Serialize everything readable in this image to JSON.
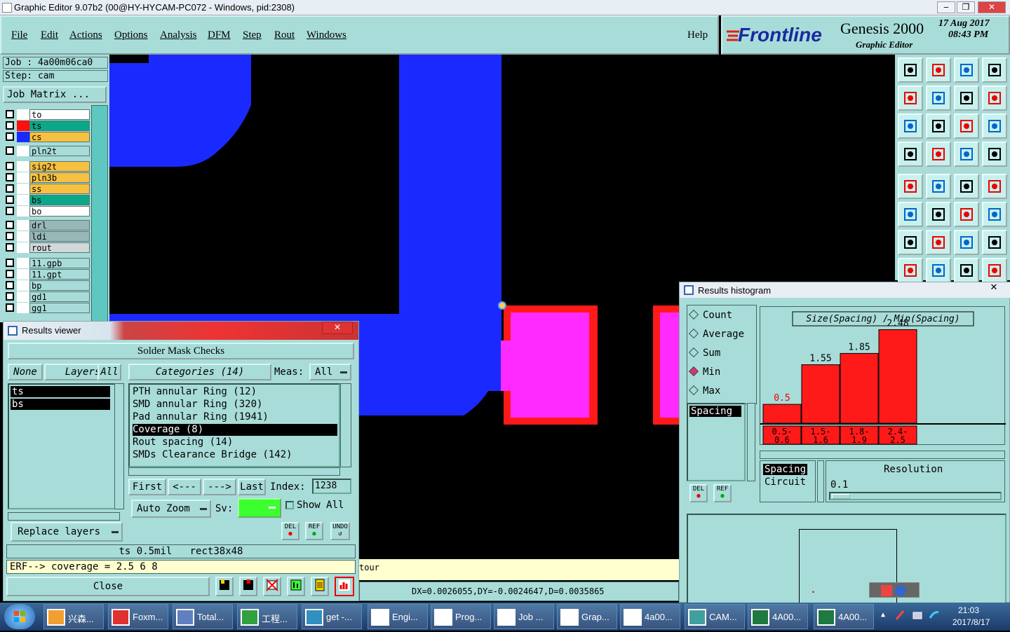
{
  "window": {
    "title": "Graphic Editor 9.07b2 (00@HY-HYCAM-PC072 - Windows, pid:2308)"
  },
  "menu": [
    "File",
    "Edit",
    "Actions",
    "Options",
    "Analysis",
    "DFM",
    "Step",
    "Rout",
    "Windows"
  ],
  "help": "Help",
  "logo": {
    "brand": "Frontline",
    "product": "Genesis 2000",
    "subtitle": "Graphic Editor",
    "date": "17 Aug 2017",
    "time": "08:43 PM"
  },
  "job": {
    "job_line": "Job : 4a00m06ca0",
    "step_line": "Step: cam",
    "matrix_button": "Job Matrix ..."
  },
  "layers": [
    {
      "name": "to",
      "color": "#ffffff",
      "swatch": "#ffffff"
    },
    {
      "name": "ts",
      "color": "#0aa888",
      "swatch": "#ff1010"
    },
    {
      "name": "cs",
      "color": "#f8c040",
      "swatch": "#1a2aff"
    },
    {
      "name": "pln2t",
      "color": "#a8dcd8",
      "swatch": "#ffffff"
    },
    {
      "name": "sig2t",
      "color": "#f8c040",
      "swatch": "#ffffff"
    },
    {
      "name": "pln3b",
      "color": "#f8c040",
      "swatch": "#ffffff"
    },
    {
      "name": "ss",
      "color": "#f8c040",
      "swatch": "#ffffff"
    },
    {
      "name": "bs",
      "color": "#0aa888",
      "swatch": "#ffffff"
    },
    {
      "name": "bo",
      "color": "#ffffff",
      "swatch": "#ffffff"
    },
    {
      "name": "drl",
      "color": "#98b8b8",
      "swatch": "#ffffff"
    },
    {
      "name": "ldi",
      "color": "#98b8b8",
      "swatch": "#ffffff"
    },
    {
      "name": "rout",
      "color": "#d0d8d8",
      "swatch": "#ffffff"
    },
    {
      "name": "11.gpb",
      "color": "#a8dcd8",
      "swatch": "#ffffff"
    },
    {
      "name": "11.gpt",
      "color": "#a8dcd8",
      "swatch": "#ffffff"
    },
    {
      "name": "bp",
      "color": "#a8dcd8",
      "swatch": "#ffffff"
    },
    {
      "name": "gd1",
      "color": "#a8dcd8",
      "swatch": "#ffffff"
    },
    {
      "name": "gg1",
      "color": "#a8dcd8",
      "swatch": "#ffffff"
    }
  ],
  "status": {
    "coords": "DX=0.0026055,DY=-0.0024647,D=0.0035865",
    "cmd_fragment": "tour"
  },
  "results_viewer": {
    "title": "Results viewer",
    "header": "Solder Mask Checks",
    "none": "None",
    "layers_btn": "Layers",
    "all": "All",
    "categories_btn": "Categories (14)",
    "meas_label": "Meas:",
    "meas_value": "All",
    "layer_items": [
      "ts",
      "bs"
    ],
    "categories": [
      "PTH annular Ring (12)",
      "SMD annular Ring (320)",
      "Pad annular Ring (1941)",
      "Coverage (8)",
      "Rout spacing (14)",
      "SMDs Clearance Bridge (142)"
    ],
    "selected_category": 3,
    "nav": {
      "first": "First",
      "prev": "<---",
      "next": "--->",
      "last": "Last",
      "index_label": "Index:",
      "index_value": "1238"
    },
    "auto_zoom": "Auto Zoom",
    "sv_label": "Sv:",
    "show_all": "Show All",
    "replace_layers": "Replace layers",
    "info_line": "ts 0.5mil   rect38x48",
    "erf_line": "ERF--> coverage = 2.5 6 8",
    "close": "Close",
    "del": "DEL",
    "ref": "REF",
    "undo": "UNDO"
  },
  "histogram": {
    "title": "Results histogram",
    "modes": [
      "Count",
      "Average",
      "Sum",
      "Min",
      "Max"
    ],
    "selected_mode": 3,
    "list_items": [
      "Spacing"
    ],
    "chart_title": "Size(Spacing) / Min(Spacing)",
    "del": "DEL",
    "ref": "REF",
    "options": [
      "Spacing",
      "Circuit"
    ],
    "resolution_label": "Resolution",
    "resolution_value": "0.1"
  },
  "chart_data": {
    "type": "bar",
    "title": "Size(Spacing) / Min(Spacing)",
    "categories": [
      "0.5-0.6",
      "1.5-1.6",
      "1.8-1.9",
      "2.4-2.5"
    ],
    "values": [
      0.5,
      1.55,
      1.85,
      2.48
    ],
    "data_labels": [
      "0.5",
      "1.55",
      "1.85",
      "2.48"
    ],
    "bar_color": "#ff1a1a",
    "ylim": [
      0,
      2.6
    ]
  },
  "taskbar": {
    "items": [
      "兴森...",
      "Foxm...",
      "Total...",
      "工程...",
      "get -...",
      "Engi...",
      "Prog...",
      "Job ...",
      "Grap...",
      "4a00...",
      "CAM...",
      "4A00...",
      "4A00..."
    ],
    "clock_time": "21:03",
    "clock_date": "2017/8/17"
  }
}
